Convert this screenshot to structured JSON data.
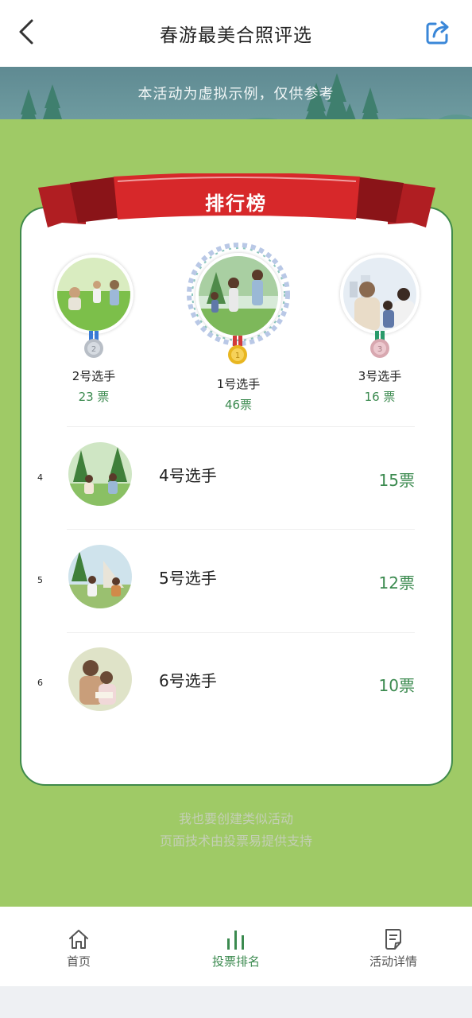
{
  "header": {
    "title": "春游最美合照评选"
  },
  "banner": {
    "notice": "本活动为虚拟示例，仅供参考"
  },
  "ribbon": {
    "label": "排行榜"
  },
  "podium": [
    {
      "rank": "2",
      "name": "2号选手",
      "votes": "23 票"
    },
    {
      "rank": "1",
      "name": "1号选手",
      "votes": "46票"
    },
    {
      "rank": "3",
      "name": "3号选手",
      "votes": "16 票"
    }
  ],
  "rows": [
    {
      "rank": "4",
      "name": "4号选手",
      "votes": "15票"
    },
    {
      "rank": "5",
      "name": "5号选手",
      "votes": "12票"
    },
    {
      "rank": "6",
      "name": "6号选手",
      "votes": "10票"
    }
  ],
  "footer": {
    "create_link": "我也要创建类似活动",
    "powered_by": "页面技术由投票易提供支持"
  },
  "tabs": [
    {
      "label": "首页",
      "icon": "home-icon"
    },
    {
      "label": "投票排名",
      "icon": "bar-chart-icon"
    },
    {
      "label": "活动详情",
      "icon": "document-icon"
    }
  ],
  "colors": {
    "green_bg": "#9fca66",
    "accent_green": "#3b8a4f",
    "ribbon_red": "#d7282a"
  }
}
